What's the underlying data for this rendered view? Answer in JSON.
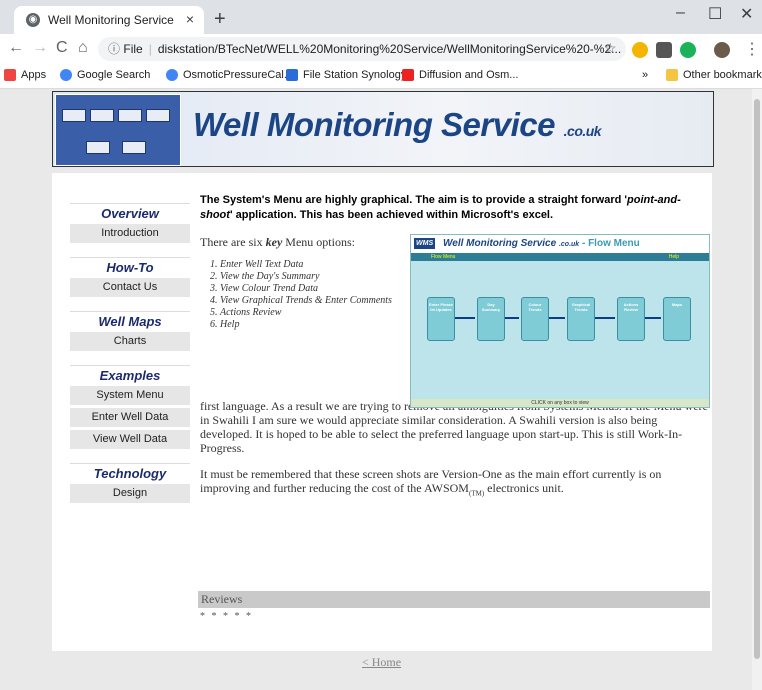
{
  "browser": {
    "tab_title": "Well Monitoring Service",
    "tab_close": "×",
    "new_tab": "+",
    "controls": {
      "minimize": "–",
      "maximize": "☐",
      "close": "✕"
    },
    "nav": {
      "back": "←",
      "forward": "→",
      "reload": "C",
      "home": "⌂"
    },
    "address_prefix": "File",
    "url": "diskstation/BTecNet/WELL%20Monitoring%20Service/WellMonitoringService%20-%2..."
  },
  "bookmarks": {
    "items": [
      "Apps",
      "Google Search",
      "OsmoticPressureCal...",
      "File Station Synology",
      "Diffusion and Osm..."
    ],
    "overflow": "»",
    "other": "Other bookmarks"
  },
  "banner": {
    "title": "Well Monitoring Service",
    "suffix": ".co.uk"
  },
  "sidenav": {
    "groups": [
      {
        "heading": "Overview",
        "items": [
          "Introduction"
        ]
      },
      {
        "heading": "How-To",
        "items": [
          "Contact Us"
        ]
      },
      {
        "heading": "Well Maps",
        "items": [
          "Charts"
        ]
      },
      {
        "heading": "Examples",
        "items": [
          "System Menu",
          "Enter Well Data",
          "View Well Data"
        ]
      },
      {
        "heading": "Technology",
        "items": [
          "Design"
        ]
      }
    ]
  },
  "main": {
    "intro_a": "The System's Menu are highly graphical.  The aim is to provide a straight forward '",
    "intro_em": "point-and-shoot",
    "intro_b": "' application.  This has been achieved within Microsoft's excel.",
    "options_a": "There are six ",
    "options_em": "key",
    "options_b": " Menu options:",
    "menu_options": [
      "Enter Well Text Data",
      "View the Day's Summary",
      "View Colour Trend Data",
      "View Graphical Trends & Enter Comments",
      "Actions Review",
      "Help"
    ],
    "paragraph1": "'Clicking' on any of the 'buttons' details that option.  It is realized that some of the terminology is a little long-winded, however we were conscious of the fact that the majority of people using this application will not have English as their first language. As a result we are trying to remove all ambiguities from Systems Menus.  If the Menu were in Swahili I am sure we would appreciate similar consideration. A Swahili version is also being developed. It is hoped to be able to select the preferred language upon start-up. This is still Work-In-Progress.",
    "paragraph2": "It must be remembered that these screen shots are Version-One as the main effort currently is on improving and further reducing the cost of the AWSOM",
    "tm": "(TM)",
    "paragraph2_end": " electronics unit."
  },
  "screenshot": {
    "logo": "WMS",
    "title": "Well Monitoring Service",
    "suffix": ".co.uk",
    "menu_label": "- Flow Menu",
    "bar_left": "Flow Menu",
    "bar_right": "Help",
    "buttons": [
      "Enter Please let Updates",
      "Day Summary",
      "Colour Trends",
      "Graphical Trends",
      "Actions Review",
      "Maps"
    ],
    "footer": "CLICK on any box to view"
  },
  "reviews": {
    "label": "Reviews",
    "stars": "* * * * *"
  },
  "footer": {
    "home_link": "< Home"
  }
}
